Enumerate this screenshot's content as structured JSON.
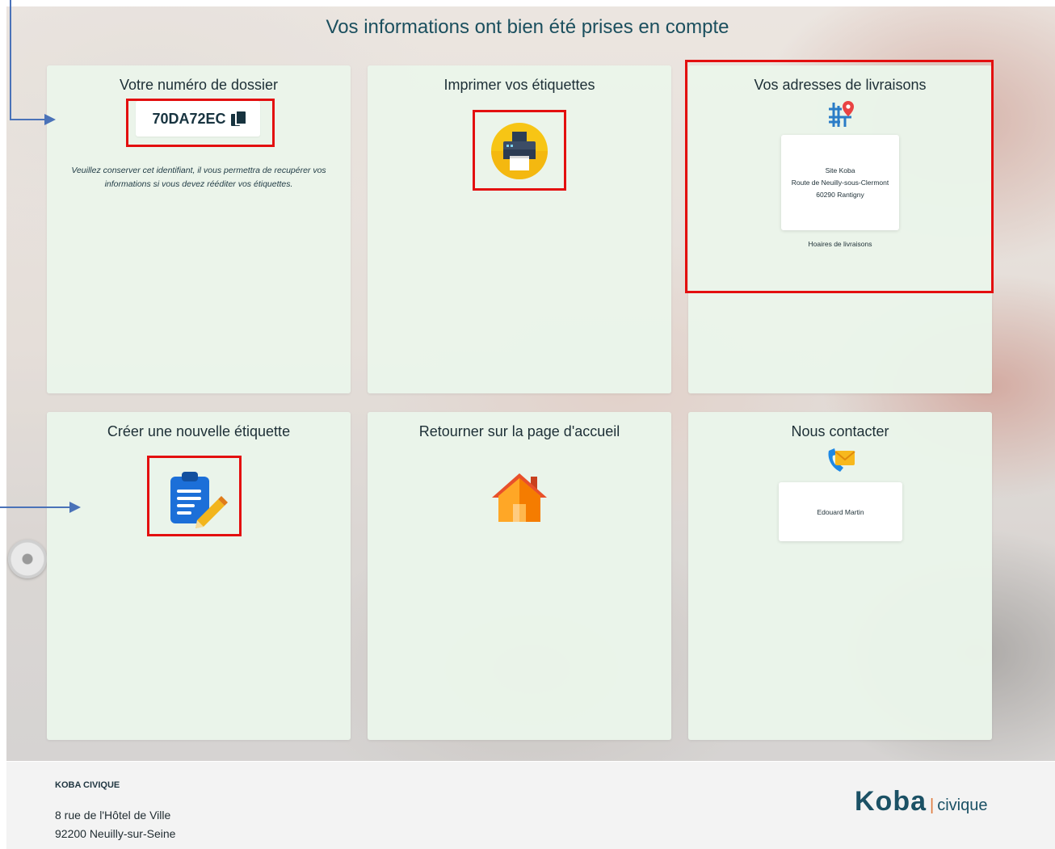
{
  "page": {
    "title": "Vos informations ont bien été prises en compte"
  },
  "cards": {
    "dossier": {
      "title": "Votre numéro de dossier",
      "number": "70DA72EC",
      "note": "Veuillez conserver cet identifiant, il vous permettra de recupérer vos informations si vous devez rééditer vos étiquettes.",
      "copy_icon": "copy-icon"
    },
    "print": {
      "title": "Imprimer vos étiquettes",
      "icon": "printer-icon"
    },
    "addresses": {
      "title": "Vos adresses de livraisons",
      "icon": "map-location-icon",
      "address_lines": [
        "Site Koba",
        "Route de Neuilly-sous-Clermont",
        "60290 Rantigny"
      ],
      "hours_link": "Hoaires de livraisons"
    },
    "new_label": {
      "title": "Créer une nouvelle étiquette",
      "icon": "clipboard-edit-icon"
    },
    "home": {
      "title": "Retourner sur la page d'accueil",
      "icon": "house-icon"
    },
    "contact": {
      "title": "Nous contacter",
      "icon": "phone-mail-icon",
      "name": "Edouard Martin"
    }
  },
  "footer": {
    "company": "KOBA CIVIQUE",
    "address_line1": "8 rue de l'Hôtel de Ville",
    "address_line2": "92200 Neuilly-sur-Seine",
    "logo_main": "Koba",
    "logo_sep": "|",
    "logo_sub": "civique"
  },
  "colors": {
    "card_bg": "#eaf5ea",
    "title_text": "#1b4f5e",
    "highlight": "#e30f0f",
    "arrow": "#4a72b8",
    "logo_accent": "#e07a3c"
  }
}
